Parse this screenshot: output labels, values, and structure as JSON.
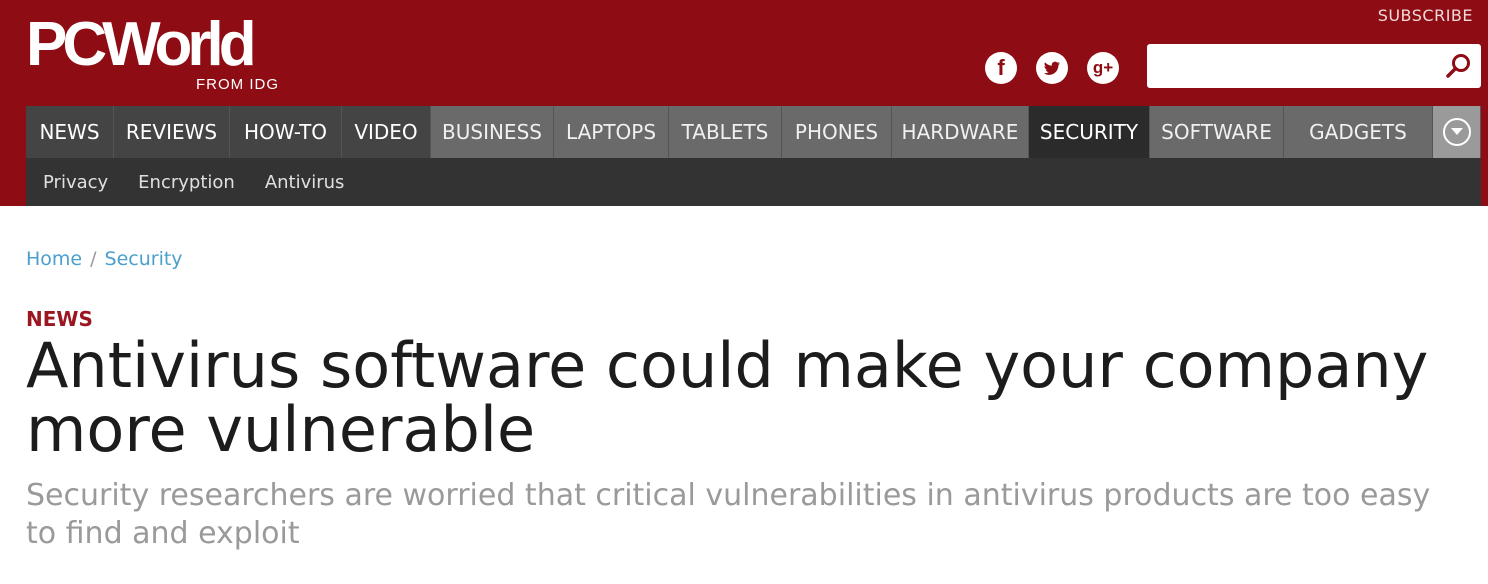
{
  "brand": {
    "name": "PCWorld",
    "tagline": "FROM IDG"
  },
  "header": {
    "subscribe_label": "SUBSCRIBE",
    "social": [
      {
        "name": "facebook",
        "glyph": "f"
      },
      {
        "name": "twitter",
        "glyph": "t"
      },
      {
        "name": "google-plus",
        "glyph": "g+"
      }
    ],
    "search": {
      "value": "",
      "placeholder": ""
    }
  },
  "nav": {
    "main": [
      {
        "label": "NEWS",
        "style": "primary"
      },
      {
        "label": "REVIEWS",
        "style": "primary"
      },
      {
        "label": "HOW-TO",
        "style": "primary"
      },
      {
        "label": "VIDEO",
        "style": "primary"
      },
      {
        "label": "BUSINESS",
        "style": "secondary"
      },
      {
        "label": "LAPTOPS",
        "style": "secondary"
      },
      {
        "label": "TABLETS",
        "style": "secondary"
      },
      {
        "label": "PHONES",
        "style": "secondary"
      },
      {
        "label": "HARDWARE",
        "style": "secondary"
      },
      {
        "label": "SECURITY",
        "style": "active"
      },
      {
        "label": "SOFTWARE",
        "style": "secondary"
      },
      {
        "label": "GADGETS",
        "style": "secondary"
      }
    ],
    "sub": [
      "Privacy",
      "Encryption",
      "Antivirus"
    ]
  },
  "breadcrumb": {
    "home": "Home",
    "separator": "/",
    "section": "Security"
  },
  "article": {
    "kicker": "NEWS",
    "headline": "Antivirus software could make your company more vulnerable",
    "deck": "Security researchers are worried that critical vulnerabilities in antivirus products are too easy to find and exploit"
  },
  "colors": {
    "brand_red": "#8e0c14",
    "link_blue": "#4a9fcd",
    "kicker_red": "#9b1620"
  }
}
